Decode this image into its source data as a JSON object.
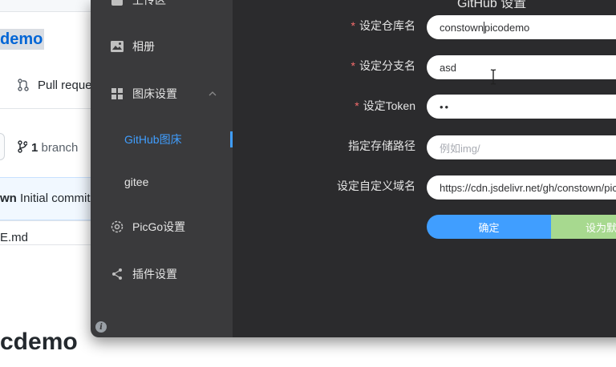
{
  "github": {
    "repo_name_fragment": "demo",
    "pull_requests_label": "Pull reque",
    "branch_count": "1",
    "branch_label": "branch",
    "commit_author_fragment": "wn",
    "commit_message": "Initial commit",
    "readme_fragment": "E.md",
    "readme_heading_fragment": "cdemo"
  },
  "picgo": {
    "title_fragment": "GitHub 设置",
    "sidebar": {
      "upload_label": "上传区",
      "album_label": "相册",
      "picbed_settings_label": "图床设置",
      "github_label": "GitHub图床",
      "gitee_label": "gitee",
      "picgo_settings_label": "PicGo设置",
      "plugin_settings_label": "插件设置"
    },
    "form": {
      "repo_label": "设定仓库名",
      "repo_value": "constown/picodemo",
      "branch_label": "设定分支名",
      "branch_value": "asd",
      "token_label": "设定Token",
      "token_value": "••",
      "path_label": "指定存储路径",
      "path_placeholder": "例如img/",
      "domain_label": "设定自定义域名",
      "domain_value": "https://cdn.jsdelivr.net/gh/constown/picodemo"
    },
    "buttons": {
      "confirm_label": "确定",
      "set_default_label": "设为默认"
    },
    "colors": {
      "accent": "#409eff",
      "required": "#f56c6c",
      "default_button": "#a7d98f"
    }
  }
}
